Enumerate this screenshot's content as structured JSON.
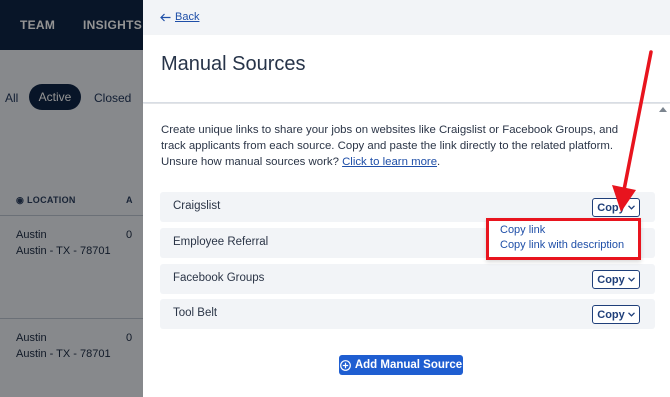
{
  "background": {
    "nav": [
      "TEAM",
      "INSIGHTS"
    ],
    "filters": {
      "all": "All",
      "active": "Active",
      "closed": "Closed"
    },
    "columns": {
      "location": "LOCATION",
      "col2": "A"
    },
    "rows": [
      {
        "city": "Austin",
        "address": "Austin - TX - 78701",
        "count": "0"
      },
      {
        "city": "Austin",
        "address": "Austin - TX - 78701",
        "count": "0"
      }
    ]
  },
  "panel": {
    "back_label": "Back",
    "title": "Manual Sources",
    "description": "Create unique links to share your jobs on websites like Craigslist or Facebook Groups, and track applicants from each source. Copy and paste the link directly to the related platform. Unsure how manual sources work?",
    "learn_more": "Click to learn more",
    "learn_more_suffix": ".",
    "copy_label": "Copy",
    "sources": [
      {
        "name": "Craigslist"
      },
      {
        "name": "Employee Referral"
      },
      {
        "name": "Facebook Groups"
      },
      {
        "name": "Tool Belt"
      }
    ],
    "add_button": "Add Manual Source"
  },
  "dropdown": {
    "items": [
      "Copy link",
      "Copy link with description"
    ]
  },
  "colors": {
    "navy": "#0f2545",
    "link": "#1f4fa8",
    "primary": "#1f5ed1",
    "annotation": "#e8141e"
  }
}
